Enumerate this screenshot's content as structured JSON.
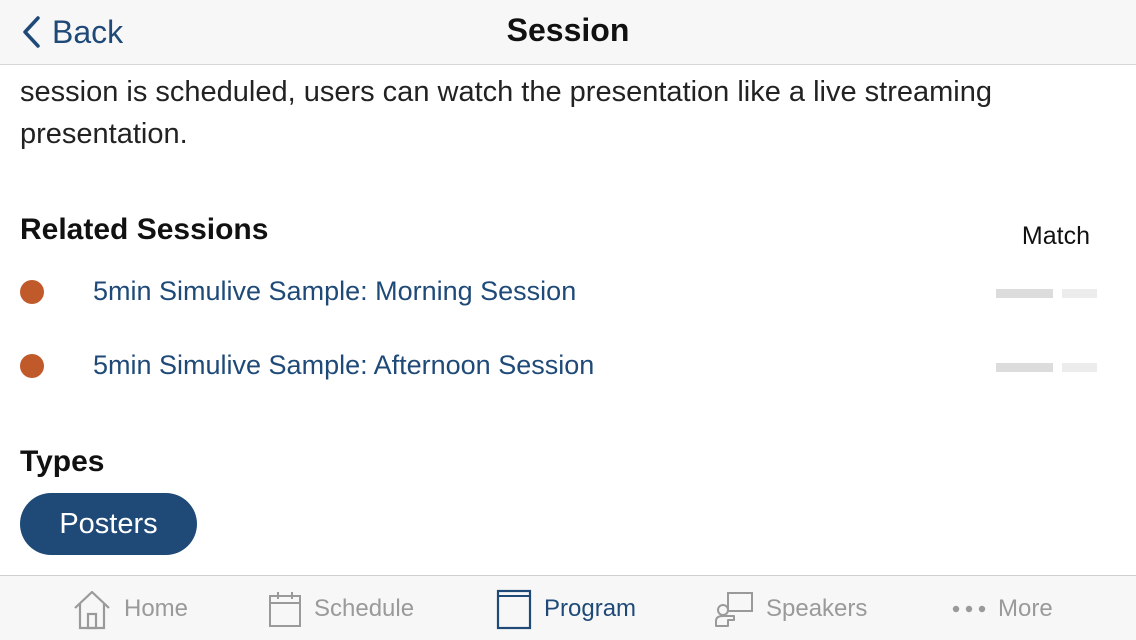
{
  "navbar": {
    "back_label": "Back",
    "title": "Session"
  },
  "description": {
    "text": "Parent session - acts as the container for all sub-session presentations. When the session is scheduled, users can watch the presentation like a live streaming presentation."
  },
  "related": {
    "heading": "Related Sessions",
    "match_label": "Match",
    "items": [
      {
        "label": "5min Simulive Sample: Morning Session",
        "dot_color": "#c05a2a"
      },
      {
        "label": "5min Simulive Sample: Afternoon Session",
        "dot_color": "#c05a2a"
      }
    ]
  },
  "types": {
    "heading": "Types",
    "tags": [
      "Posters"
    ]
  },
  "tabbar": {
    "active": "Program",
    "tabs": [
      {
        "label": "Home",
        "icon": "home-icon"
      },
      {
        "label": "Schedule",
        "icon": "calendar-icon"
      },
      {
        "label": "Program",
        "icon": "book-icon"
      },
      {
        "label": "Speakers",
        "icon": "speaker-presentation-icon"
      },
      {
        "label": "More",
        "icon": "more-dots-icon"
      }
    ]
  },
  "colors": {
    "accent": "#1f4a78",
    "dot": "#c05a2a",
    "inactive": "#9a9a9a",
    "bar_background": "#f7f7f7"
  }
}
